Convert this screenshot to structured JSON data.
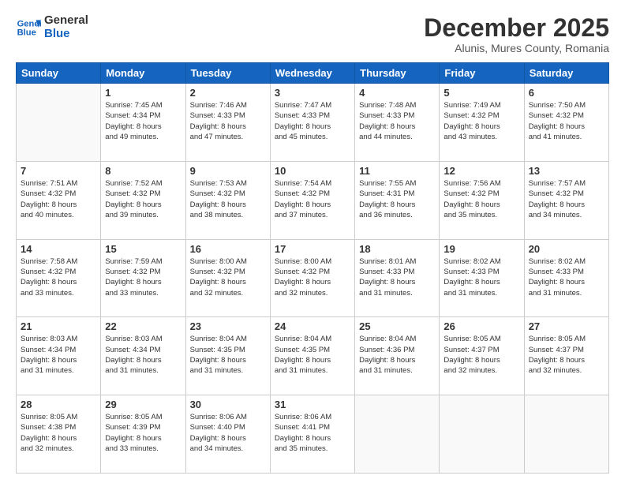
{
  "logo": {
    "line1": "General",
    "line2": "Blue"
  },
  "title": "December 2025",
  "subtitle": "Alunis, Mures County, Romania",
  "weekdays": [
    "Sunday",
    "Monday",
    "Tuesday",
    "Wednesday",
    "Thursday",
    "Friday",
    "Saturday"
  ],
  "weeks": [
    [
      {
        "day": "",
        "info": ""
      },
      {
        "day": "1",
        "info": "Sunrise: 7:45 AM\nSunset: 4:34 PM\nDaylight: 8 hours\nand 49 minutes."
      },
      {
        "day": "2",
        "info": "Sunrise: 7:46 AM\nSunset: 4:33 PM\nDaylight: 8 hours\nand 47 minutes."
      },
      {
        "day": "3",
        "info": "Sunrise: 7:47 AM\nSunset: 4:33 PM\nDaylight: 8 hours\nand 45 minutes."
      },
      {
        "day": "4",
        "info": "Sunrise: 7:48 AM\nSunset: 4:33 PM\nDaylight: 8 hours\nand 44 minutes."
      },
      {
        "day": "5",
        "info": "Sunrise: 7:49 AM\nSunset: 4:32 PM\nDaylight: 8 hours\nand 43 minutes."
      },
      {
        "day": "6",
        "info": "Sunrise: 7:50 AM\nSunset: 4:32 PM\nDaylight: 8 hours\nand 41 minutes."
      }
    ],
    [
      {
        "day": "7",
        "info": "Sunrise: 7:51 AM\nSunset: 4:32 PM\nDaylight: 8 hours\nand 40 minutes."
      },
      {
        "day": "8",
        "info": "Sunrise: 7:52 AM\nSunset: 4:32 PM\nDaylight: 8 hours\nand 39 minutes."
      },
      {
        "day": "9",
        "info": "Sunrise: 7:53 AM\nSunset: 4:32 PM\nDaylight: 8 hours\nand 38 minutes."
      },
      {
        "day": "10",
        "info": "Sunrise: 7:54 AM\nSunset: 4:32 PM\nDaylight: 8 hours\nand 37 minutes."
      },
      {
        "day": "11",
        "info": "Sunrise: 7:55 AM\nSunset: 4:31 PM\nDaylight: 8 hours\nand 36 minutes."
      },
      {
        "day": "12",
        "info": "Sunrise: 7:56 AM\nSunset: 4:32 PM\nDaylight: 8 hours\nand 35 minutes."
      },
      {
        "day": "13",
        "info": "Sunrise: 7:57 AM\nSunset: 4:32 PM\nDaylight: 8 hours\nand 34 minutes."
      }
    ],
    [
      {
        "day": "14",
        "info": "Sunrise: 7:58 AM\nSunset: 4:32 PM\nDaylight: 8 hours\nand 33 minutes."
      },
      {
        "day": "15",
        "info": "Sunrise: 7:59 AM\nSunset: 4:32 PM\nDaylight: 8 hours\nand 33 minutes."
      },
      {
        "day": "16",
        "info": "Sunrise: 8:00 AM\nSunset: 4:32 PM\nDaylight: 8 hours\nand 32 minutes."
      },
      {
        "day": "17",
        "info": "Sunrise: 8:00 AM\nSunset: 4:32 PM\nDaylight: 8 hours\nand 32 minutes."
      },
      {
        "day": "18",
        "info": "Sunrise: 8:01 AM\nSunset: 4:33 PM\nDaylight: 8 hours\nand 31 minutes."
      },
      {
        "day": "19",
        "info": "Sunrise: 8:02 AM\nSunset: 4:33 PM\nDaylight: 8 hours\nand 31 minutes."
      },
      {
        "day": "20",
        "info": "Sunrise: 8:02 AM\nSunset: 4:33 PM\nDaylight: 8 hours\nand 31 minutes."
      }
    ],
    [
      {
        "day": "21",
        "info": "Sunrise: 8:03 AM\nSunset: 4:34 PM\nDaylight: 8 hours\nand 31 minutes."
      },
      {
        "day": "22",
        "info": "Sunrise: 8:03 AM\nSunset: 4:34 PM\nDaylight: 8 hours\nand 31 minutes."
      },
      {
        "day": "23",
        "info": "Sunrise: 8:04 AM\nSunset: 4:35 PM\nDaylight: 8 hours\nand 31 minutes."
      },
      {
        "day": "24",
        "info": "Sunrise: 8:04 AM\nSunset: 4:35 PM\nDaylight: 8 hours\nand 31 minutes."
      },
      {
        "day": "25",
        "info": "Sunrise: 8:04 AM\nSunset: 4:36 PM\nDaylight: 8 hours\nand 31 minutes."
      },
      {
        "day": "26",
        "info": "Sunrise: 8:05 AM\nSunset: 4:37 PM\nDaylight: 8 hours\nand 32 minutes."
      },
      {
        "day": "27",
        "info": "Sunrise: 8:05 AM\nSunset: 4:37 PM\nDaylight: 8 hours\nand 32 minutes."
      }
    ],
    [
      {
        "day": "28",
        "info": "Sunrise: 8:05 AM\nSunset: 4:38 PM\nDaylight: 8 hours\nand 32 minutes."
      },
      {
        "day": "29",
        "info": "Sunrise: 8:05 AM\nSunset: 4:39 PM\nDaylight: 8 hours\nand 33 minutes."
      },
      {
        "day": "30",
        "info": "Sunrise: 8:06 AM\nSunset: 4:40 PM\nDaylight: 8 hours\nand 34 minutes."
      },
      {
        "day": "31",
        "info": "Sunrise: 8:06 AM\nSunset: 4:41 PM\nDaylight: 8 hours\nand 35 minutes."
      },
      {
        "day": "",
        "info": ""
      },
      {
        "day": "",
        "info": ""
      },
      {
        "day": "",
        "info": ""
      }
    ]
  ]
}
